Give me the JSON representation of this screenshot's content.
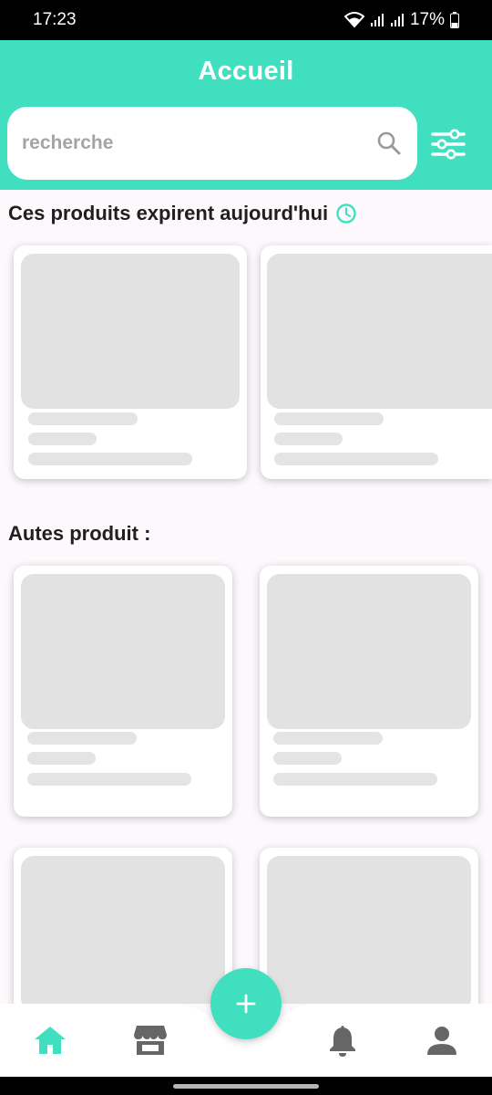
{
  "status_bar": {
    "time": "17:23",
    "battery": "17%"
  },
  "header": {
    "title": "Accueil"
  },
  "search": {
    "placeholder": "recherche",
    "value": ""
  },
  "sections": {
    "expiring": {
      "title": "Ces produits expirent aujourd'hui",
      "icon": "clock-icon"
    },
    "others": {
      "title": "Autes produit :"
    }
  },
  "bottom_nav": {
    "items": [
      "home-icon",
      "store-icon",
      "add-icon",
      "bell-icon",
      "profile-icon"
    ],
    "active": "home-icon"
  },
  "colors": {
    "accent": "#40dfc0",
    "skeleton": "#e2e2e2",
    "inactive_icon": "#666666"
  }
}
